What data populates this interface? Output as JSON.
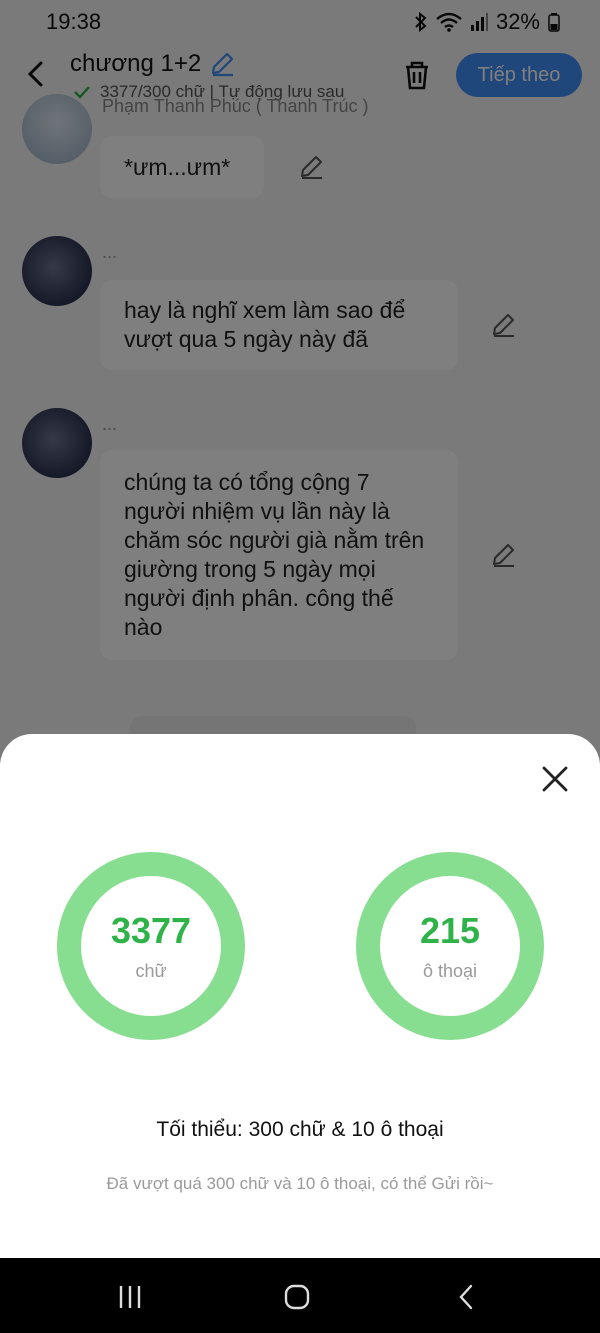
{
  "status_bar": {
    "time": "19:38",
    "battery": "32%"
  },
  "header": {
    "title": "chương 1+2",
    "subtitle": "3377/300 chữ | Tự động lưu sau",
    "next_label": "Tiếp theo"
  },
  "chat": {
    "name_top": "Phạm Thanh Phúc ( Thanh Trúc )",
    "dots": "...",
    "messages": [
      "*ưm...ưm*",
      "hay là nghĩ xem làm sao để vượt qua 5 ngày này đã",
      "chúng ta có tổng cộng 7 người nhiệm vụ lần này là chăm sóc người già nằm trên giường trong 5 ngày mọi người định phân. công thế nào"
    ]
  },
  "sheet": {
    "words_value": "3377",
    "words_label": "chữ",
    "dialogs_value": "215",
    "dialogs_label": "ô thoại",
    "minimum": "Tối thiểu: 300 chữ & 10 ô thoại",
    "hint": "Đã vượt quá 300 chữ và 10 ô thoại, có thể Gửi rồi~"
  },
  "colors": {
    "ring": "#88de90",
    "value": "#2fb349",
    "accent": "#3e8ef7"
  },
  "icons": [
    "back-arrow-icon",
    "pencil-icon",
    "check-icon",
    "trash-icon",
    "close-icon",
    "recents-icon",
    "home-icon",
    "nav-back-icon",
    "bluetooth-icon",
    "wifi-icon",
    "signal-icon",
    "battery-icon"
  ]
}
